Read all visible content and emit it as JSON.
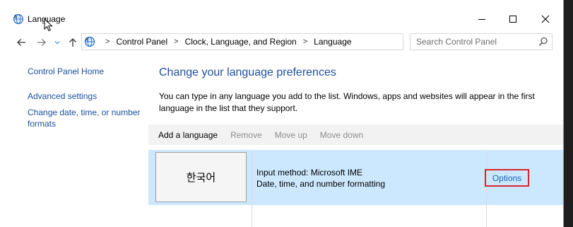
{
  "window": {
    "title": "Language",
    "icons": {
      "app": "language-globe-icon",
      "minimize": "minimize-icon",
      "maximize": "maximize-icon",
      "close": "close-icon"
    }
  },
  "nav": {
    "breadcrumbs": [
      "Control Panel",
      "Clock, Language, and Region",
      "Language"
    ],
    "separator": ">",
    "search_placeholder": "Search Control Panel"
  },
  "sidebar": {
    "home": "Control Panel Home",
    "links": [
      "Advanced settings",
      "Change date, time, or number formats"
    ]
  },
  "main": {
    "title": "Change your language preferences",
    "description": "You can type in any language you add to the list. Windows, apps and websites will appear in the first language in the list that they support.",
    "toolbar": [
      {
        "label": "Add a language",
        "enabled": true
      },
      {
        "label": "Remove",
        "enabled": false
      },
      {
        "label": "Move up",
        "enabled": false
      },
      {
        "label": "Move down",
        "enabled": false
      }
    ],
    "languages": [
      {
        "name": "한국어",
        "input_method": "Input method: Microsoft IME",
        "formatting": "Date, time, and number formatting",
        "options_label": "Options"
      }
    ]
  },
  "colors": {
    "link": "#1a4f9c",
    "heading": "#1e4e9e",
    "selected_row": "#cce8ff",
    "highlight_box": "#d7262b"
  }
}
